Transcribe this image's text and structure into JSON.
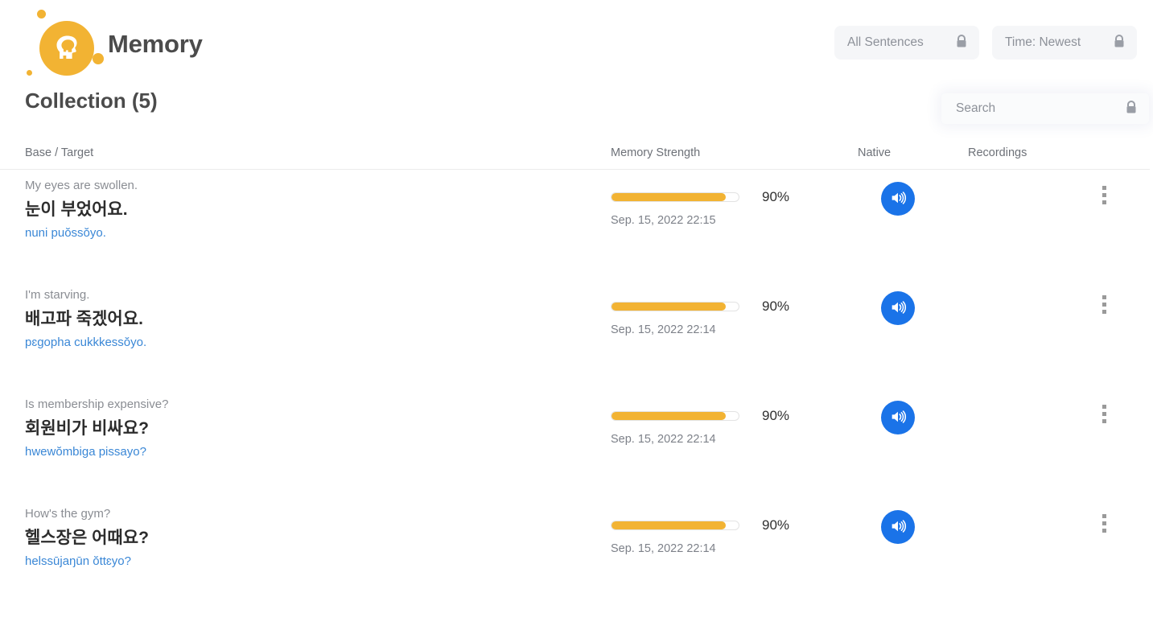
{
  "app": {
    "title": "Memory",
    "logo_icon": "brain-head-logo",
    "brand_color": "#F2B333"
  },
  "header": {
    "filters": [
      {
        "label": "All Sentences",
        "icon": "lock-icon"
      },
      {
        "label": "Time: Newest",
        "icon": "lock-icon"
      }
    ]
  },
  "collection": {
    "title": "Collection (5)",
    "search": {
      "placeholder": "Search",
      "value": "",
      "icon": "lock-icon"
    },
    "columns": {
      "base_target": "Base / Target",
      "memory_strength": "Memory Strength",
      "native": "Native",
      "recordings": "Recordings"
    }
  },
  "rows": [
    {
      "base": "My eyes are swollen.",
      "target": "눈이 부었어요.",
      "romanization": "nuni puŏssŏyo.",
      "strength_pct": 90,
      "strength_label": "90%",
      "date": "Sep. 15, 2022 22:15",
      "native_icon": "speaker-icon",
      "menu_icon": "kebab-menu-icon"
    },
    {
      "base": "I'm starving.",
      "target": "배고파 죽겠어요.",
      "romanization": "pɛgopha cukkkessŏyo.",
      "strength_pct": 90,
      "strength_label": "90%",
      "date": "Sep. 15, 2022 22:14",
      "native_icon": "speaker-icon",
      "menu_icon": "kebab-menu-icon"
    },
    {
      "base": "Is membership expensive?",
      "target": "회원비가 비싸요?",
      "romanization": "hwewŏmbiga pissayo?",
      "strength_pct": 90,
      "strength_label": "90%",
      "date": "Sep. 15, 2022 22:14",
      "native_icon": "speaker-icon",
      "menu_icon": "kebab-menu-icon"
    },
    {
      "base": "How's the gym?",
      "target": "헬스장은 어때요?",
      "romanization": "helssūjaŋūn ŏttɛyo?",
      "strength_pct": 90,
      "strength_label": "90%",
      "date": "Sep. 15, 2022 22:14",
      "native_icon": "speaker-icon",
      "menu_icon": "kebab-menu-icon"
    }
  ]
}
